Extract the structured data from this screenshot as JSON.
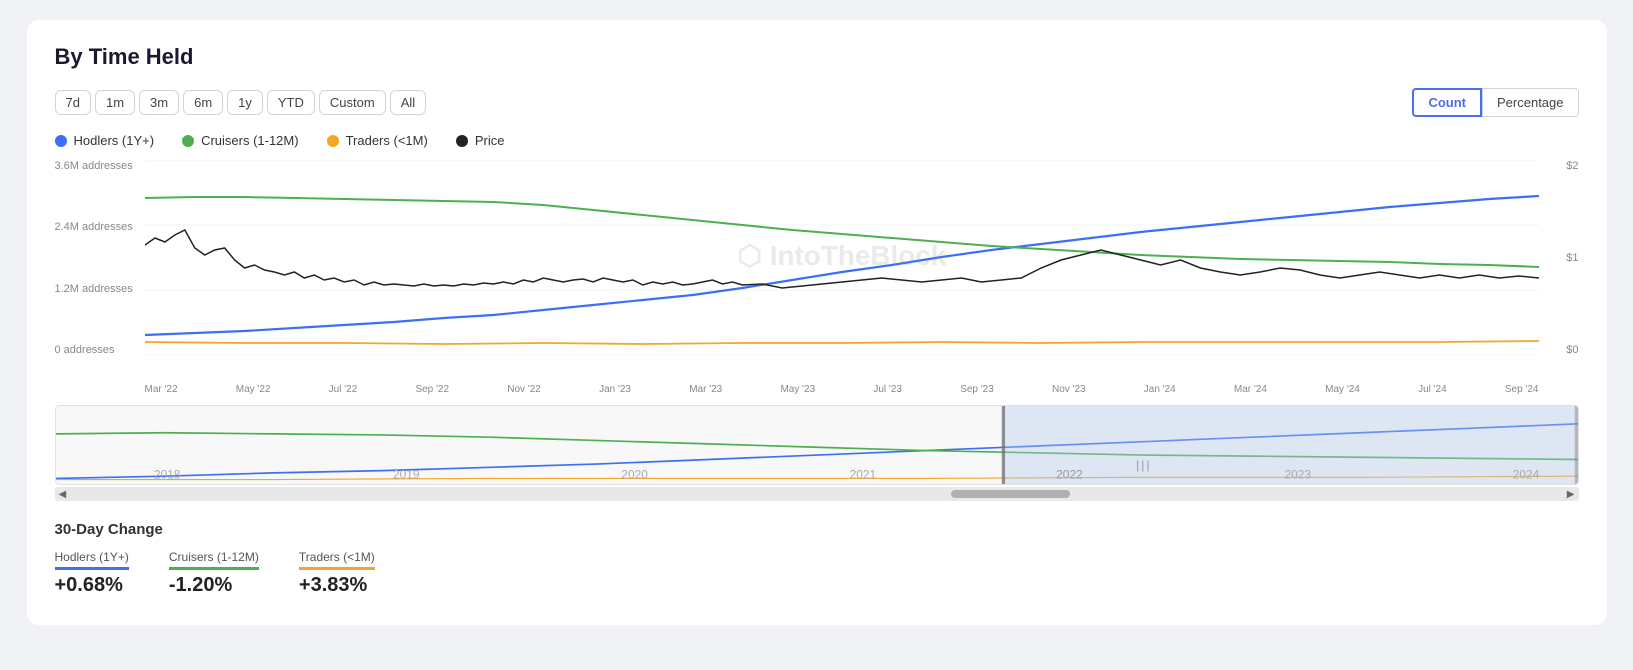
{
  "page": {
    "title": "By Time Held"
  },
  "toolbar": {
    "time_filters": [
      "7d",
      "1m",
      "3m",
      "6m",
      "1y",
      "YTD",
      "Custom",
      "All"
    ],
    "active_filter": "All",
    "view_options": [
      "Count",
      "Percentage"
    ],
    "active_view": "Count"
  },
  "legend": [
    {
      "label": "Hodlers (1Y+)",
      "color": "#3b6ff5",
      "type": "circle"
    },
    {
      "label": "Cruisers (1-12M)",
      "color": "#4caf50",
      "type": "circle"
    },
    {
      "label": "Traders (<1M)",
      "color": "#f5a623",
      "type": "circle"
    },
    {
      "label": "Price",
      "color": "#222222",
      "type": "circle"
    }
  ],
  "chart": {
    "y_axis_left": [
      "3.6M addresses",
      "2.4M addresses",
      "1.2M addresses",
      "0 addresses"
    ],
    "y_axis_right": [
      "$2",
      "$1",
      "$0"
    ],
    "x_axis_labels": [
      "Mar '22",
      "May '22",
      "Jul '22",
      "Sep '22",
      "Nov '22",
      "Jan '23",
      "Mar '23",
      "May '23",
      "Jul '23",
      "Sep '23",
      "Nov '23",
      "Jan '24",
      "Mar '24",
      "May '24",
      "Jul '24",
      "Sep '24"
    ],
    "watermark": "IntoTheBlock"
  },
  "mini_chart": {
    "x_labels": [
      "2018",
      "2019",
      "2020",
      "2021",
      "2022",
      "2023",
      "2024"
    ]
  },
  "bottom": {
    "section_title": "30-Day Change",
    "metrics": [
      {
        "label": "Hodlers (1Y+)",
        "value": "+0.68%",
        "color": "#3b6ff5"
      },
      {
        "label": "Cruisers (1-12M)",
        "value": "-1.20%",
        "color": "#4caf50"
      },
      {
        "label": "Traders (<1M)",
        "value": "+3.83%",
        "color": "#f5a623"
      }
    ]
  }
}
